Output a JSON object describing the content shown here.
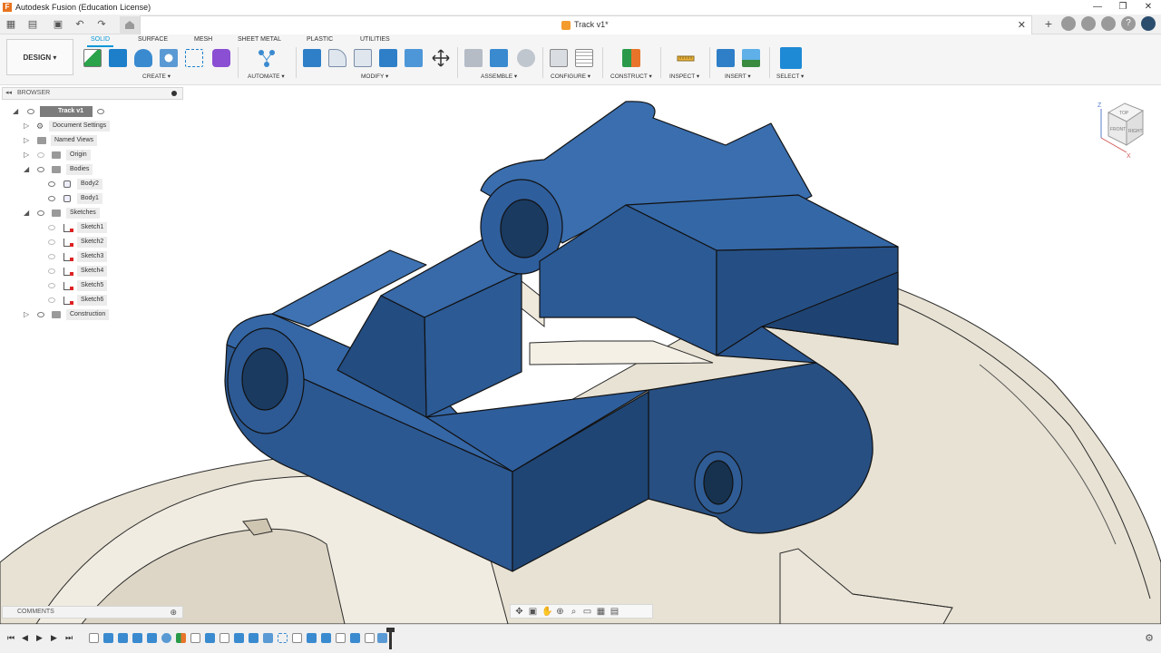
{
  "window": {
    "title": "Autodesk Fusion (Education License)",
    "controls": [
      "—",
      "❐",
      "✕"
    ]
  },
  "document": {
    "tab_title": "Track v1*",
    "close": "✕"
  },
  "toolbar": {
    "workspace": "DESIGN ▾",
    "tabs": [
      "SOLID",
      "SURFACE",
      "MESH",
      "SHEET METAL",
      "PLASTIC",
      "UTILITIES"
    ],
    "active_tab": "SOLID",
    "groups": [
      "CREATE ▾",
      "AUTOMATE ▾",
      "MODIFY ▾",
      "ASSEMBLE ▾",
      "CONFIGURE ▾",
      "CONSTRUCT ▾",
      "INSPECT ▾",
      "INSERT ▾",
      "SELECT ▾"
    ]
  },
  "browser": {
    "header": "BROWSER",
    "root": "Track v1",
    "items": [
      {
        "label": "Document Settings"
      },
      {
        "label": "Named Views"
      },
      {
        "label": "Origin"
      },
      {
        "label": "Bodies"
      },
      {
        "label": "Body2"
      },
      {
        "label": "Body1"
      },
      {
        "label": "Sketches"
      },
      {
        "label": "Sketch1"
      },
      {
        "label": "Sketch2"
      },
      {
        "label": "Sketch3"
      },
      {
        "label": "Sketch4"
      },
      {
        "label": "Sketch5"
      },
      {
        "label": "Sketch6"
      },
      {
        "label": "Construction"
      }
    ]
  },
  "comments": {
    "header": "COMMENTS"
  },
  "viewcube": {
    "top": "TOP",
    "front": "FRONT",
    "right": "RIGHT",
    "axis_z": "Z",
    "axis_x": "X"
  },
  "colors": {
    "accent": "#0696d7",
    "part_blue": "#2e5a91",
    "part_tan": "#e8e2d4"
  }
}
